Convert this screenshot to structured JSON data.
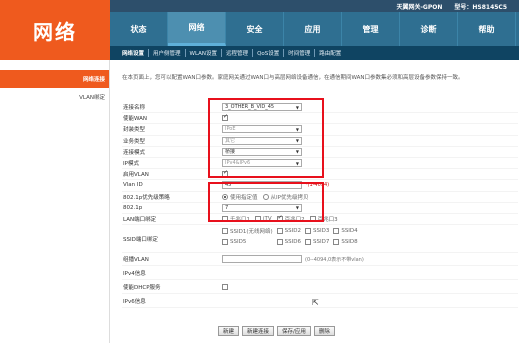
{
  "header": {
    "logo": "网络",
    "gateway_name": "天翼网关-GPON",
    "model": "型号：HS8145C5"
  },
  "nav": [
    {
      "label": "状态"
    },
    {
      "label": "网络"
    },
    {
      "label": "安全"
    },
    {
      "label": "应用"
    },
    {
      "label": "管理"
    },
    {
      "label": "诊断"
    },
    {
      "label": "帮助"
    }
  ],
  "subnav": [
    {
      "label": "网络设置"
    },
    {
      "label": "用户侧管理"
    },
    {
      "label": "WLAN设置"
    },
    {
      "label": "远程管理"
    },
    {
      "label": "QoS设置"
    },
    {
      "label": "时间管理"
    },
    {
      "label": "路由配置"
    }
  ],
  "sidebar": [
    {
      "label": "网络连接"
    },
    {
      "label": "VLAN绑定"
    }
  ],
  "content": {
    "description": "在本页面上，您可以配置WAN口参数。家庭网关通过WAN口与高层网络设备通信，在通信期间WAN口参数集必须和高层设备参数保持一致。",
    "fields": {
      "conn_name_label": "连接名称",
      "conn_name_value": "3_OTHER_B_VID_45",
      "use_wan_label": "使能WAN",
      "encap_label": "封装类型",
      "encap_value": "IPoE",
      "service_label": "业务类型",
      "service_value": "其它",
      "mode_label": "连接模式",
      "mode_value": "桥接",
      "ip_mode_label": "IP模式",
      "ip_mode_value": "IPv4&IPv6",
      "vlan_enable_label": "启用VLAN",
      "vlan_id_label": "Vlan ID",
      "vlan_id_value": "45",
      "vlan_id_hint": "*(1-4094)",
      "p8021_policy_label": "802.1p优先级策略",
      "p8021_opt1": "使用指定值",
      "p8021_opt2": "从IP优先级拷贝",
      "p8021_label": "802.1p",
      "p8021_value": "7",
      "lan_bind_label": "LAN端口绑定",
      "lan_ports": [
        "千兆口1",
        "iTV",
        "百兆口2",
        "百兆口3"
      ],
      "ssid_bind_label": "SSID端口绑定",
      "ssids": [
        "SSID1(无线网络)",
        "SSID2",
        "SSID3",
        "SSID4",
        "SSID5",
        "SSID6",
        "SSID7",
        "SSID8"
      ],
      "multicast_vlan_label": "组播VLAN",
      "multicast_vlan_hint": "(0--4094,0表示不带vlan)",
      "ipv4_info_label": "IPv4信息",
      "dhcp_label": "使能DHCP服务",
      "ipv6_info_label": "IPv6信息"
    },
    "buttons": {
      "new": "新建",
      "new_conn": "新建连接",
      "save": "保存/应用",
      "delete": "删除"
    }
  },
  "colors": {
    "brand_orange": "#ef5a1e",
    "nav_blue": "#2f6f91",
    "subnav_dark": "#0f4462",
    "highlight_red": "#e8101c"
  }
}
